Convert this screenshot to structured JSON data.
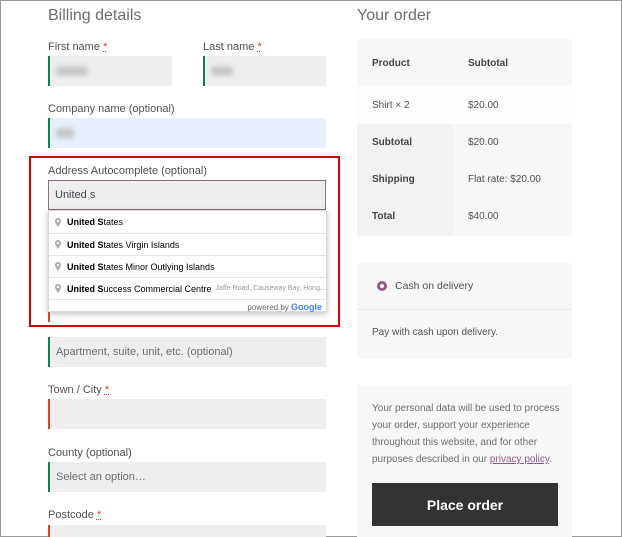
{
  "billing": {
    "title": "Billing details",
    "first_name_label": "First name",
    "last_name_label": "Last name",
    "company_label": "Company name (optional)",
    "address_label": "Address Autocomplete (optional)",
    "address_value": "United s",
    "apartment_placeholder": "Apartment, suite, unit, etc. (optional)",
    "town_label": "Town / City",
    "county_label": "County (optional)",
    "county_placeholder": "Select an option…",
    "postcode_label": "Postcode",
    "required_mark": "*"
  },
  "autocomplete": {
    "items": [
      {
        "match": "United S",
        "rest": "tates",
        "secondary": ""
      },
      {
        "match": "United S",
        "rest": "tates Virgin Islands",
        "secondary": ""
      },
      {
        "match": "United S",
        "rest": "tates Minor Outlying Islands",
        "secondary": ""
      },
      {
        "match": "United S",
        "rest": "uccess Commercial Centre",
        "secondary": "Jaffe Road, Causeway Bay, Hong..."
      }
    ],
    "powered_by": "powered by",
    "google": "Google"
  },
  "order": {
    "title": "Your order",
    "header_product": "Product",
    "header_subtotal": "Subtotal",
    "item_name": "Shirt × 2",
    "item_subtotal": "$20.00",
    "subtotal_label": "Subtotal",
    "subtotal_value": "$20.00",
    "shipping_label": "Shipping",
    "shipping_value": "Flat rate: $20.00",
    "total_label": "Total",
    "total_value": "$40.00"
  },
  "payment": {
    "method_label": "Cash on delivery",
    "description": "Pay with cash upon delivery.",
    "privacy_text": "Your personal data will be used to process your order, support your experience throughout this website, and for other purposes described in our",
    "privacy_link": "privacy policy",
    "privacy_end": ".",
    "place_order": "Place order"
  },
  "colors": {
    "accent": "#96588a",
    "error": "#e2401c",
    "valid": "#0f834d",
    "highlight": "#e00000"
  }
}
